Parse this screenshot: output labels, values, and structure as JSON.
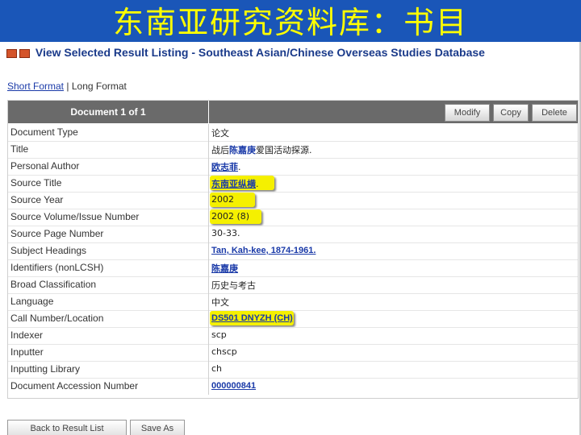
{
  "slide_title": "东南亚研究资料库：书目",
  "page_heading": "View Selected Result Listing - Southeast Asian/Chinese Overseas Studies Database",
  "format": {
    "short": "Short Format",
    "divider": "|",
    "long": "Long Format"
  },
  "document_header": "Document 1 of 1",
  "actions": {
    "modify": "Modify",
    "copy": "Copy",
    "delete": "Delete"
  },
  "fields": [
    {
      "label": "Document Type",
      "value": "论文"
    },
    {
      "label": "Title",
      "value_pre": "战后",
      "value_hl": "陈嘉庚",
      "value_post": "爱国活动探源."
    },
    {
      "label": "Personal Author",
      "value": "欧志菲",
      "suffix": "."
    },
    {
      "label": "Source Title",
      "value": "东南亚纵横",
      "suffix": "."
    },
    {
      "label": "Source Year",
      "value": "2002"
    },
    {
      "label": "Source Volume/Issue Number",
      "value": "2002 (8)"
    },
    {
      "label": "Source Page Number",
      "value": "30-33."
    },
    {
      "label": "Subject Headings",
      "value": "Tan, Kah-kee, 1874-1961."
    },
    {
      "label": "Identifiers (nonLCSH)",
      "value": "陈嘉庚"
    },
    {
      "label": "Broad Classification",
      "value": "历史与考古"
    },
    {
      "label": "Language",
      "value": "中文"
    },
    {
      "label": "Call Number/Location",
      "value": "DS501 DNYZH (CH)"
    },
    {
      "label": "Indexer",
      "value": "scp"
    },
    {
      "label": "Inputter",
      "value": "chscp"
    },
    {
      "label": "Inputting Library",
      "value": "ch"
    },
    {
      "label": "Document Accession Number",
      "value": "000000841"
    }
  ],
  "bottom_buttons": {
    "back": "Back to Result List",
    "save": "Save As"
  },
  "colors": {
    "slide_bg": "#1a56b8",
    "title": "#ffff00",
    "highlight": "#f5f000",
    "link": "#1a3aa8"
  }
}
